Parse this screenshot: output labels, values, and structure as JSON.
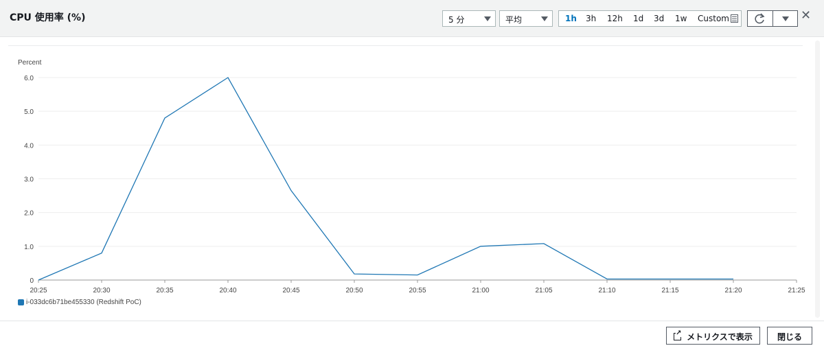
{
  "header": {
    "title": "CPU 使用率 (%)",
    "period_select": "5 分",
    "stat_select": "平均",
    "ranges": [
      "1h",
      "3h",
      "12h",
      "1d",
      "3d",
      "1w",
      "Custom"
    ],
    "active_range": "1h"
  },
  "footer": {
    "view_metrics_label": "メトリクスで表示",
    "close_label": "閉じる"
  },
  "colors": {
    "series": "#1f77b4",
    "active": "#0073bb",
    "grid": "#eeeeee"
  },
  "chart_data": {
    "type": "line",
    "title": "",
    "ylabel": "Percent",
    "xlabel": "",
    "ylim": [
      0,
      6
    ],
    "y_ticks": [
      "0",
      "1.0",
      "2.0",
      "3.0",
      "4.0",
      "5.0",
      "6.0"
    ],
    "x_ticks": [
      "20:25",
      "20:30",
      "20:35",
      "20:40",
      "20:45",
      "20:50",
      "20:55",
      "21:00",
      "21:05",
      "21:10",
      "21:15",
      "21:20",
      "21:25"
    ],
    "grid": true,
    "legend_position": "bottom-left",
    "series": [
      {
        "name": "i-033dc6b71be455330 (Redshift PoC)",
        "x": [
          "20:25",
          "20:30",
          "20:35",
          "20:40",
          "20:45",
          "20:50",
          "20:55",
          "21:00",
          "21:05",
          "21:10",
          "21:15",
          "21:20"
        ],
        "values": [
          0.0,
          0.8,
          4.8,
          6.0,
          2.65,
          0.18,
          0.15,
          1.0,
          1.08,
          0.03,
          0.03,
          0.03
        ]
      }
    ]
  }
}
